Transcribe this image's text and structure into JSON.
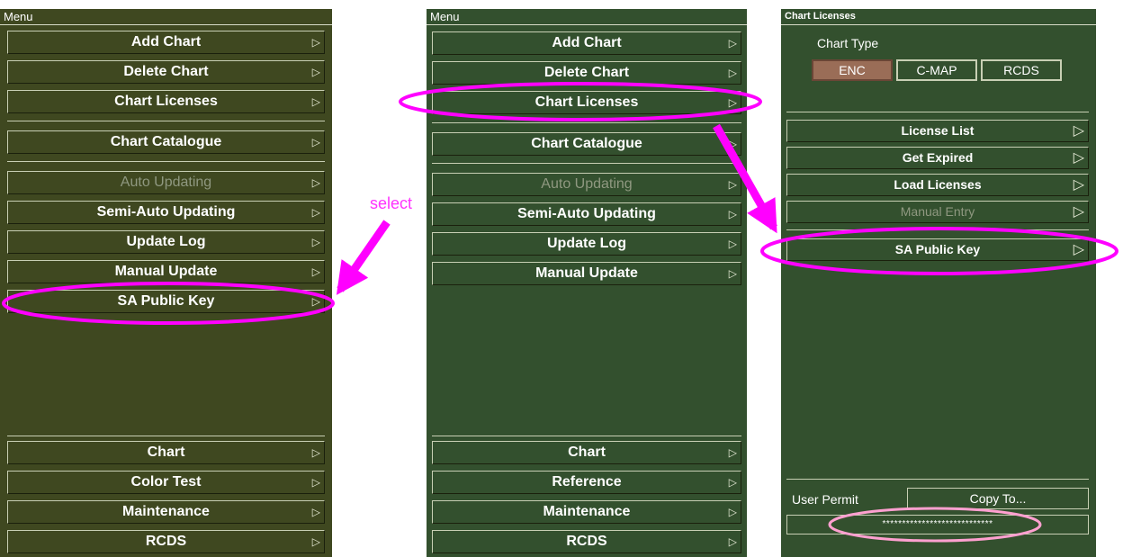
{
  "panel1": {
    "title": "Menu",
    "items": [
      {
        "label": "Add Chart",
        "arrow": "▷"
      },
      {
        "label": "Delete Chart",
        "arrow": "▷"
      },
      {
        "label": "Chart Licenses",
        "arrow": "▷"
      },
      {
        "label": "Chart Catalogue",
        "arrow": "▷"
      },
      {
        "label": "Auto Updating",
        "arrow": "▷"
      },
      {
        "label": "Semi-Auto Updating",
        "arrow": "▷"
      },
      {
        "label": "Update Log",
        "arrow": "▷"
      },
      {
        "label": "Manual Update",
        "arrow": "▷"
      },
      {
        "label": "SA Public Key",
        "arrow": "▷"
      }
    ],
    "bottom_items": [
      {
        "label": "Chart",
        "arrow": "▷"
      },
      {
        "label": "Color Test",
        "arrow": "▷"
      },
      {
        "label": "Maintenance",
        "arrow": "▷"
      },
      {
        "label": "RCDS",
        "arrow": "▷"
      }
    ]
  },
  "panel2": {
    "title": "Menu",
    "items": [
      {
        "label": "Add Chart",
        "arrow": "▷"
      },
      {
        "label": "Delete Chart",
        "arrow": "▷"
      },
      {
        "label": "Chart Licenses",
        "arrow": "▷"
      },
      {
        "label": "Chart Catalogue",
        "arrow": "▷"
      },
      {
        "label": "Auto Updating",
        "arrow": "▷"
      },
      {
        "label": "Semi-Auto Updating",
        "arrow": "▷"
      },
      {
        "label": "Update Log",
        "arrow": "▷"
      },
      {
        "label": "Manual Update",
        "arrow": "▷"
      }
    ],
    "bottom_items": [
      {
        "label": "Chart",
        "arrow": "▷"
      },
      {
        "label": "Reference",
        "arrow": "▷"
      },
      {
        "label": "Maintenance",
        "arrow": "▷"
      },
      {
        "label": "RCDS",
        "arrow": "▷"
      }
    ]
  },
  "panel3": {
    "title": "Chart Licenses",
    "chart_type_label": "Chart Type",
    "chart_types": [
      "ENC",
      "C-MAP",
      "RCDS"
    ],
    "selected_chart_type": "ENC",
    "items": [
      {
        "label": "License List",
        "arrow": "▷"
      },
      {
        "label": "Get Expired",
        "arrow": "▷"
      },
      {
        "label": "Load Licenses",
        "arrow": "▷"
      },
      {
        "label": "Manual Entry",
        "arrow": "▷"
      },
      {
        "label": "SA Public Key",
        "arrow": "▷"
      }
    ],
    "user_permit_label": "User Permit",
    "copy_to_label": "Copy To...",
    "user_permit_value": "****************************"
  },
  "annotation": {
    "select_label": "select",
    "highlight_color": "#ff00ff"
  },
  "colors": {
    "panel1_bg": "#3f4820",
    "panel_green_bg": "#33502e",
    "active_segment": "#9a6d57"
  }
}
